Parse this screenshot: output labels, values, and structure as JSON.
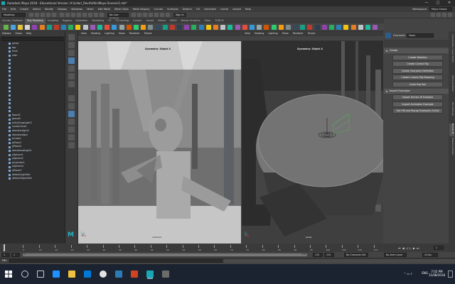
{
  "window": {
    "title": "Autodesk Maya 2018 - Educational Version: H:\\Lidar\\_Revit\\Utils\\Maya Scenes\\1.mb*",
    "minimize": "—",
    "maximize": "□",
    "close": "✕"
  },
  "menubar": {
    "items": [
      "File",
      "Edit",
      "Create",
      "Select",
      "Modify",
      "Display",
      "Windows",
      "Mesh",
      "Edit Mesh",
      "Mesh Tools",
      "Mesh Display",
      "Curves",
      "Surfaces",
      "Deform",
      "UV",
      "Generate",
      "Cache",
      "Arnold",
      "Help"
    ],
    "workspace_label": "Workspace:",
    "workspace_value": "Maya Classic"
  },
  "statusline": {
    "mode": "Modeling",
    "live_surface": "No Live Surface",
    "sign_in": "Sign In"
  },
  "shelf": {
    "tabs": [
      "Curves / Surfaces",
      "Poly Modeling",
      "Sculpting",
      "Rigging",
      "Animation",
      "Rendering",
      "FX",
      "FX Caching",
      "Custom",
      "Arnold",
      "Bifrost",
      "MASH",
      "Motion Graphics",
      "XGen",
      "TURTLE"
    ],
    "active_tab": "Poly Modeling",
    "icon_colors": [
      "#6ab04c",
      "#4aa3df",
      "#e0c341",
      "#d6d6d6",
      "#8e44ad",
      "#e67e22",
      "#16a085",
      "#c0392b",
      "#2980b9",
      "#27ae60",
      "#f1c40f",
      "#bdc3c7",
      "#9b59b6",
      "#1abc9c",
      "#e74c3c",
      "#3498db",
      "#95a5a6",
      "#d35400",
      "#2ecc71",
      "#f39c12",
      "#7f8c8d",
      "#34495e",
      "#16a085",
      "#c0392b",
      "#2c3e50",
      "#8e44ad",
      "#27ae60",
      "#2980b9",
      "#f1c40f",
      "#e67e22",
      "#bdc3c7",
      "#1abc9c",
      "#9b59b6",
      "#e74c3c",
      "#3498db",
      "#95a5a6",
      "#d35400",
      "#2ecc71",
      "#f39c12",
      "#7f8c8d",
      "#34495e",
      "#16a085",
      "#c0392b",
      "#2c3e50",
      "#8e44ad",
      "#27ae60",
      "#2980b9",
      "#f1c40f",
      "#e67e22",
      "#bdc3c7",
      "#1abc9c",
      "#9b59b6"
    ]
  },
  "outliner": {
    "menu": [
      "Display",
      "Show",
      "Help"
    ],
    "items": [
      "persp",
      "top",
      "front",
      "side",
      "",
      "",
      "",
      "",
      "",
      "",
      "",
      "",
      "",
      "",
      "",
      "",
      "",
      "",
      "floorA1",
      "group9",
      "pCitySnowLight3",
      "nurbsCircle1",
      "directionlight2",
      "directionlight",
      "pCube1",
      "pPlane1",
      "pPlane2",
      "directionalLight1",
      "pSphere1",
      "pSphere2",
      "pCylinder1",
      "pSphere4",
      "pPlane3",
      "defaultLightSet",
      "defaultObjectSet"
    ]
  },
  "toolbox": {
    "tools": [
      "select-tool",
      "lasso-tool",
      "paint-select-tool",
      "move-tool",
      "rotate-tool",
      "scale-tool",
      "last-tool",
      "layout-single",
      "layout-four",
      "layout-two",
      "layout-persp-graph",
      "layout-outliner",
      "layout-split",
      "layout-custom"
    ]
  },
  "viewport1": {
    "menu": [
      "View",
      "Shading",
      "Lighting",
      "Show",
      "Renderer",
      "Panels"
    ],
    "label": "Symmetry: Object X",
    "cam": "camera1"
  },
  "viewport2": {
    "menu": [
      "View",
      "Shading",
      "Lighting",
      "Show",
      "Renderer",
      "Panels"
    ],
    "label": "Symmetry: Object X",
    "cam": "persp"
  },
  "rightpanel": {
    "character_label": "Character:",
    "character_value": "None",
    "sections": {
      "create": {
        "title": "Create",
        "buttons": [
          "Create Skeleton",
          "Create Control Rig",
          "Create Character Definition",
          "Create Custom Rig Mapping",
          "Quick Rig Tool"
        ]
      },
      "import": {
        "title": "Import Examples",
        "buttons": [
          "Import Human IK Example",
          "Import Animation Example",
          "Get HIK and Mocap Examples Online"
        ]
      }
    },
    "side_tabs": [
      "Channel Box / Layer Editor",
      "Attribute Editor",
      "Tool Settings",
      "Human IK",
      "Modeling Toolkit"
    ]
  },
  "timeslider": {
    "ticks": [
      "5",
      "10",
      "15",
      "20",
      "25",
      "30",
      "35",
      "40",
      "45",
      "50",
      "55",
      "60",
      "65",
      "70",
      "75",
      "80",
      "85",
      "90",
      "95",
      "100",
      "105",
      "110",
      "115"
    ],
    "current_frame": "1",
    "range_start": "1",
    "range_start2": "1",
    "range_mid": "1",
    "range_end": "115",
    "range_end2": "115",
    "range_end3": "115",
    "character_set": "No Character Set",
    "anim_layer": "No Anim Layer",
    "fps": "24 fps"
  },
  "cmdline": {
    "lang": "MEL"
  },
  "taskbar": {
    "lang": "ENG",
    "time": "7:02 PM",
    "date": "11/08/2018"
  }
}
